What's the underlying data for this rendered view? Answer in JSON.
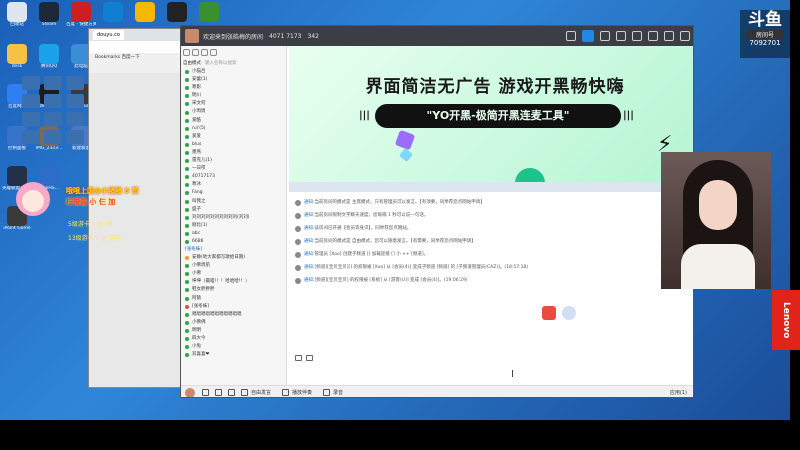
{
  "desktop": {
    "icons": [
      {
        "label": "回收站",
        "color": "#dfe6ee"
      },
      {
        "label": "Steam",
        "color": "#1b2838"
      },
      {
        "label": "百度 · 快捷方式",
        "color": "#cc1f1f"
      },
      {
        "label": "",
        "color": "#0e7fd1"
      },
      {
        "label": "",
        "color": "#f5b700"
      },
      {
        "label": "",
        "color": "#222222"
      },
      {
        "label": "",
        "color": "#3a8f2f"
      },
      {
        "label": "desk",
        "color": "#f6c243"
      },
      {
        "label": "腾讯QQ",
        "color": "#1aa3e8"
      },
      {
        "label": "此电脑",
        "color": "#3b8ed6"
      },
      {
        "label": "百度网盘",
        "color": "#2f7ff2"
      },
      {
        "label": "WeGame",
        "color": "#1c1c1c"
      },
      {
        "label": "OBS Studio",
        "color": "#3a3a3a"
      },
      {
        "label": "控制面板",
        "color": "#3773c8"
      },
      {
        "label": "IMG_2323...",
        "color": "#7a6a5a"
      },
      {
        "label": "新建联盟",
        "color": "#4b78c8"
      },
      {
        "label": "英雄联盟 WeGame版",
        "color": "#23304a"
      },
      {
        "label": "vivoHS...",
        "color": "#2d6cc8"
      },
      {
        "label": "iPoint Game",
        "color": "#3a3a3a"
      }
    ]
  },
  "browser": {
    "tab": "douyu.co",
    "bookmark": "Bookmarks",
    "bookmark2": "百度一下"
  },
  "overlay": {
    "line1": "哦哦上国@小猪猪 8 赞",
    "line2": "柠檬酱 小 仨 加",
    "line3": "5级游卡 1 @ PK",
    "line4": "13级游卡 1 @ 百花"
  },
  "stream": {
    "logo": "斗鱼",
    "sub": "房间号",
    "room": "7092701",
    "brand": "Lenovo"
  },
  "app": {
    "title": "欢迎来到张皓梅的房间 ",
    "title2": "4071 7173",
    "online_count": "342",
    "mode": "自由模式",
    "search_placeholder": "输入名称以搜索",
    "members": [
      {
        "name": "小猫吕",
        "color": "#2ea44f"
      },
      {
        "name": "安蕾(1)",
        "color": "#2ea44f"
      },
      {
        "name": "寒影",
        "color": "#2ea44f"
      },
      {
        "name": "明川",
        "color": "#2ea44f"
      },
      {
        "name": "宋文何",
        "color": "#2ea44f"
      },
      {
        "name": "小周周",
        "color": "#2ea44f"
      },
      {
        "name": "爱酷",
        "color": "#2ea44f"
      },
      {
        "name": "rui'(5)",
        "color": "#2ea44f"
      },
      {
        "name": "爱爱",
        "color": "#2ea44f"
      },
      {
        "name": "blus",
        "color": "#2ea44f"
      },
      {
        "name": "墨燕",
        "color": "#2ea44f"
      },
      {
        "name": "雷克儿(1)",
        "color": "#2ea44f"
      },
      {
        "name": "一日哎",
        "color": "#2ea44f"
      },
      {
        "name": "40717173",
        "color": "#2ea44f"
      },
      {
        "name": "寒冰",
        "color": "#2ea44f"
      },
      {
        "name": "Fang",
        "color": "#2ea44f"
      },
      {
        "name": "叫我之",
        "color": "#2ea44f"
      },
      {
        "name": "盛子",
        "color": "#2ea44f"
      },
      {
        "name": "刘刘刘刘刘刘刘刘刘刘(刘刘)",
        "color": "#2ea44f"
      },
      {
        "name": "刚比(1)",
        "color": "#2ea44f"
      },
      {
        "name": "abc",
        "color": "#2ea44f"
      },
      {
        "name": "6686",
        "color": "#2ea44f"
      }
    ],
    "channel": "[张冬妹]",
    "channel_members": [
      {
        "name": "安静(地大家都写歌给日期)",
        "color": "#f0a020"
      },
      {
        "name": "小佛周航",
        "color": "#2ea44f"
      },
      {
        "name": "小佛",
        "color": "#2ea44f"
      },
      {
        "name": "坤坤（最喵!！！哈哈哈!！）",
        "color": "#2ea44f"
      },
      {
        "name": "鞋女胖胖胖",
        "color": "#2ea44f"
      },
      {
        "name": "阿猿",
        "color": "#2ea44f"
      },
      {
        "name": "[张冬妹]",
        "color": "#e94b3c"
      },
      {
        "name": "唱唱唱唱唱唱唱唱唱唱唱",
        "color": "#2ea44f"
      },
      {
        "name": "小佛佛",
        "color": "#2ea44f"
      },
      {
        "name": "明明",
        "color": "#2ea44f"
      },
      {
        "name": "四大今",
        "color": "#2ea44f"
      },
      {
        "name": "小兔",
        "color": "#2ea44f"
      },
      {
        "name": "双喜喜❤",
        "color": "#2ea44f"
      }
    ],
    "banner": {
      "title": "界面简洁无广告   游戏开黑畅快嗨",
      "pill": "\"YO开黑-极简开黑连麦工具\""
    },
    "messages": [
      {
        "pre": "通知:",
        "text": "当前房间的模式是 主席模式，只有管理员可以发言。【有须要，同举荐您点网站申请】"
      },
      {
        "pre": "通知:",
        "text": "当前房间限制文字聊天速度，您每隔 1 秒可以说一句话。"
      },
      {
        "pre": "通知:",
        "text": "该房间已开通【会员等身识】，同举荐您点网站。"
      },
      {
        "pre": "通知:",
        "text": "当前房间的模式是 自由模式，您可以随意发言。【有需要，同举荐您点网站申请】"
      },
      {
        "pre": "通知:",
        "text": "管理员 [Xoo] 创建子频道 [] 加载迎接                    [] 小 ++ [频道]。"
      },
      {
        "pre": "通知:",
        "text": "[频道][宝贝宝贝][] 的权限被 [Xoo] 从 [会员(4)] 变成子频道 [频道]  的 [子频道管理员(CAZ)]。(18:57:18)"
      },
      {
        "pre": "通知:",
        "text": "[频道][宝贝宝贝] 的权限被 [系统] 从 [游客(U)] 变成 [会员(4)]。(19:06:29)"
      }
    ],
    "bottom": {
      "label1": "自由发言",
      "label2": "播放伴奏",
      "label3": "录音",
      "label4": "应用(1)"
    }
  }
}
